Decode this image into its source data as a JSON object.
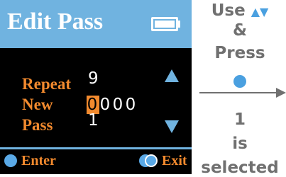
{
  "screen": {
    "title": "Edit Pass",
    "battery_icon": "battery-full-icon",
    "labels": {
      "repeat": "Repeat",
      "new": "New",
      "pass": "Pass"
    },
    "values": {
      "repeat": "9",
      "new_digits": [
        "0",
        "0",
        "0",
        "0"
      ],
      "selected_digit_index": 0,
      "pass": "1"
    },
    "nav": {
      "up_icon": "triangle-up-icon",
      "down_icon": "triangle-down-icon"
    },
    "footer": {
      "enter_label": "Enter",
      "exit_label": "Exit"
    }
  },
  "instructions": {
    "line1_prefix": "Use",
    "line1_arrows": "▲▼",
    "line2": "&",
    "line3": "Press",
    "line4": "1",
    "line5": "is",
    "line6": "selected"
  },
  "colors": {
    "accent_blue": "#70b3e0",
    "label_orange": "#f28a2e",
    "background": "#000000",
    "text_gray": "#707070"
  }
}
